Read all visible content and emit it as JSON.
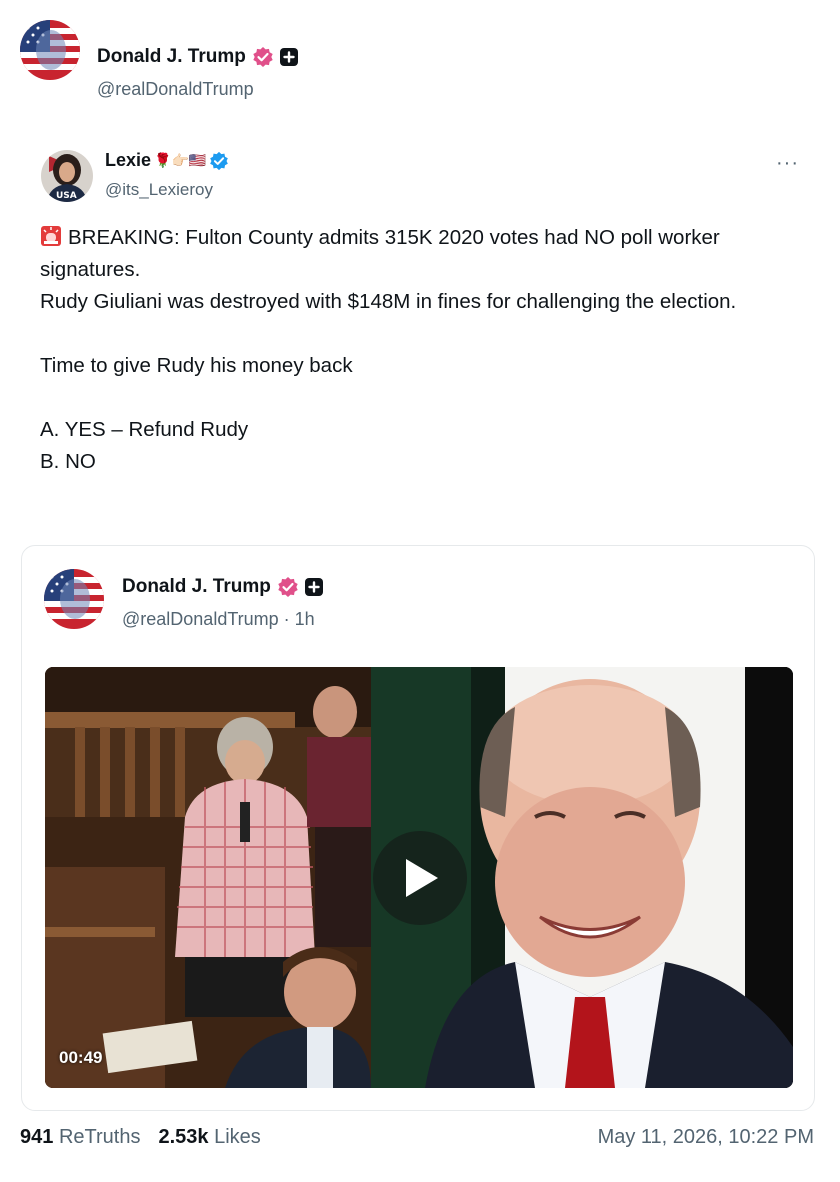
{
  "header": {
    "display_name": "Donald J. Trump",
    "handle": "@realDonaldTrump"
  },
  "quoted_post": {
    "display_name": "Lexie",
    "name_emojis": "🌹👉🏻🇺🇸",
    "handle": "@its_Lexieroy",
    "avatar_text": "USA",
    "more_label": "···",
    "body": {
      "line1": "BREAKING: Fulton County admits 315K 2020 votes had NO poll worker signatures.",
      "line2": "Rudy Giuliani was destroyed with $148M in fines for challenging the election.",
      "line3": "Time to give Rudy his money back",
      "line4": "A. YES – Refund Rudy",
      "line5": "B. NO"
    }
  },
  "embed": {
    "display_name": "Donald J. Trump",
    "handle": "@realDonaldTrump",
    "separator": " · ",
    "age": "1h",
    "video_duration": "00:49"
  },
  "footer": {
    "retruths_count": "941",
    "retruths_label": "ReTruths",
    "likes_count": "2.53k",
    "likes_label": "Likes",
    "timestamp": "May 11, 2026, 10:22 PM"
  },
  "colors": {
    "text_primary": "#0f1419",
    "text_secondary": "#536471",
    "verified_pink": "#e0508a",
    "verified_blue": "#1d9bf0",
    "border": "#e6e9eb"
  },
  "icons": [
    "flag-avatar",
    "verified-badge-icon",
    "plus-badge-icon",
    "blue-check-icon",
    "siren-icon",
    "more-icon",
    "play-icon"
  ]
}
